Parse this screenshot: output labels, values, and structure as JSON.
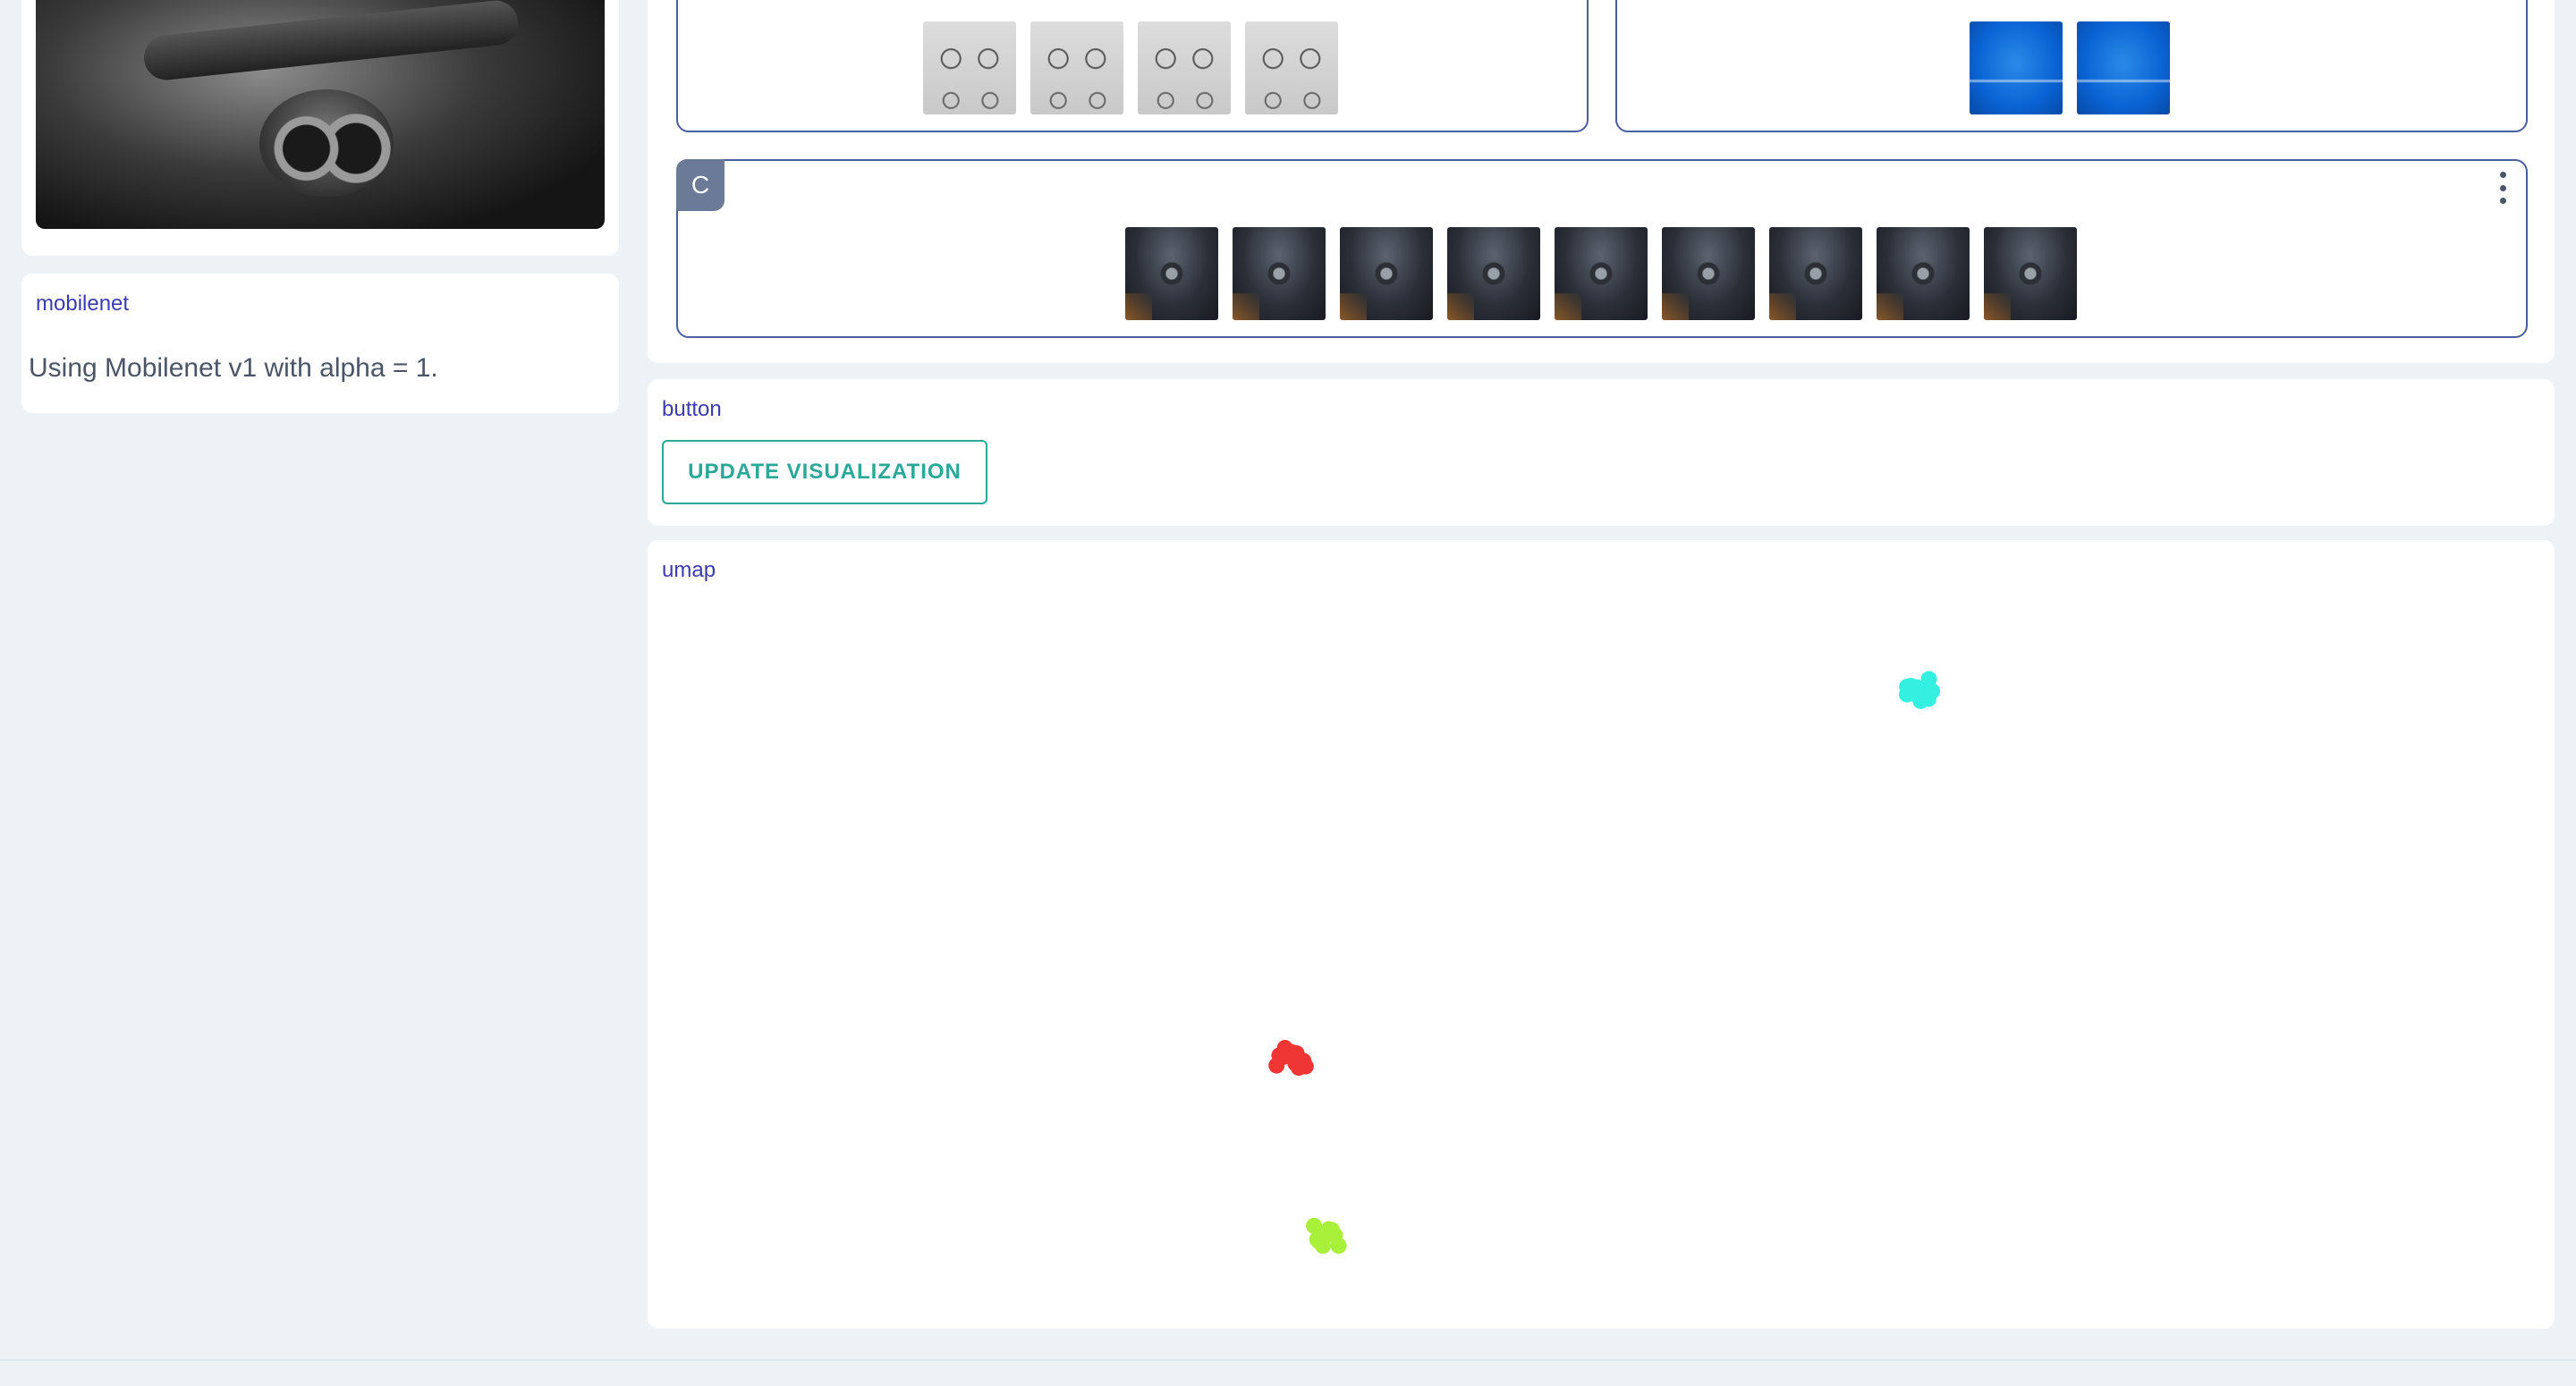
{
  "sidebar": {
    "mobilenet": {
      "title": "mobilenet",
      "text": "Using Mobilenet v1 with alpha = 1."
    }
  },
  "dataset": {
    "classes": [
      {
        "label": "",
        "thumbnail_type": "bicycle-wallpaper",
        "visible_rows": 2
      },
      {
        "label": "",
        "thumbnail_type": "blue-screen",
        "visible_rows": 2
      },
      {
        "label": "C",
        "thumbnail_type": "person-with-goggles",
        "visible_rows": 1
      }
    ]
  },
  "button": {
    "title": "button",
    "label": "UPDATE VISUALIZATION"
  },
  "umap": {
    "title": "umap",
    "clusters": [
      {
        "color": "#33f0e0",
        "count": 14
      },
      {
        "color": "#f03535",
        "count": 16
      },
      {
        "color": "#a8f03a",
        "count": 13
      }
    ]
  },
  "colors": {
    "accent": "#2aa898",
    "module_title": "#3b3bb3",
    "class_border": "#4a5fa0",
    "background": "#edf2f7"
  }
}
